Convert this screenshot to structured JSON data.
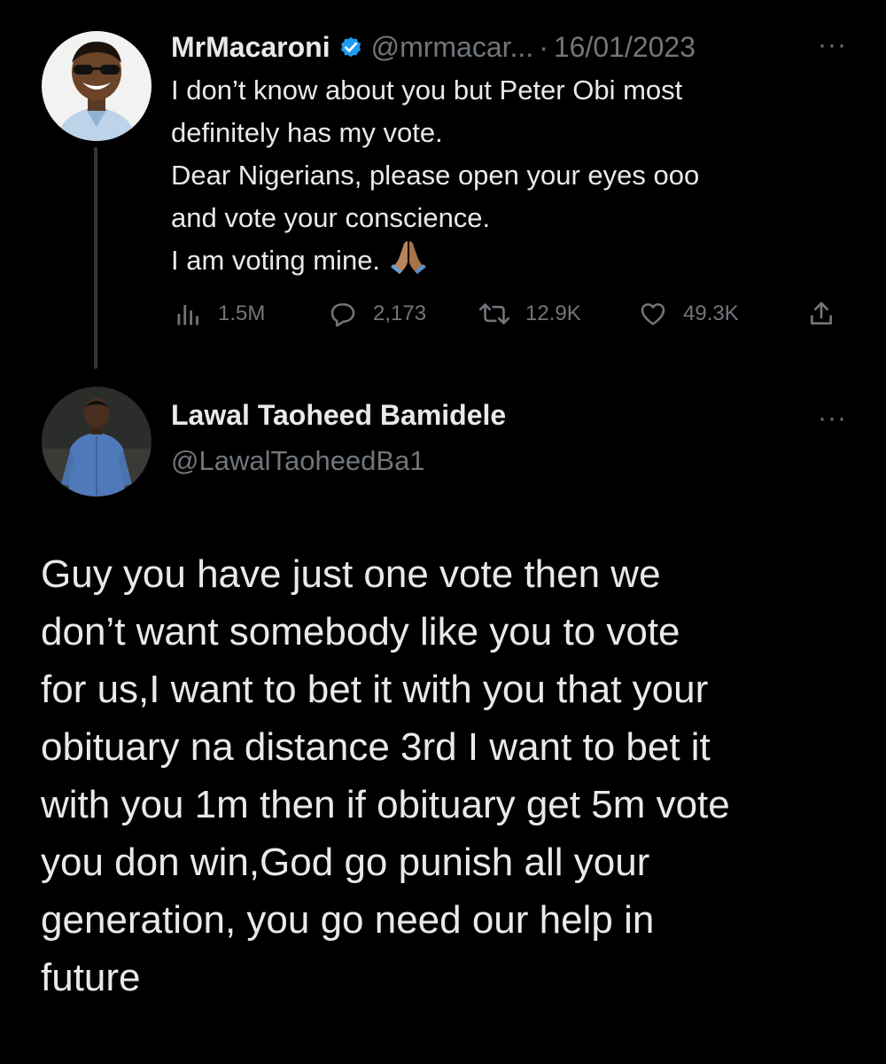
{
  "tweet": {
    "author_name": "MrMacaroni",
    "handle": "@mrmacar...",
    "separator": "·",
    "date": "16/01/2023",
    "more_label": "···",
    "lines": [
      "I don’t know about you but Peter Obi most",
      "definitely has my vote.",
      "Dear Nigerians, please open your eyes ooo",
      "and vote your conscience.",
      "I am voting mine."
    ],
    "emoji": "folded-hands-icon",
    "metrics": {
      "views": "1.5M",
      "replies": "2,173",
      "retweets": "12.9K",
      "likes": "49.3K"
    }
  },
  "reply": {
    "author_name": "Lawal Taoheed Bamidele",
    "handle": "@LawalTaoheedBa1",
    "more_label": "···",
    "lines": [
      "Guy you have just one vote then we",
      "don’t want somebody like you to vote",
      "for us,I want to bet it with you that your",
      "obituary na distance 3rd I want to bet it",
      "with you 1m then if obituary get 5m vote",
      "you don win,God go punish all your",
      "generation, you go need our help in",
      "future"
    ]
  },
  "colors": {
    "background": "#000000",
    "text": "#e7e9ea",
    "muted": "#71767b",
    "verified": "#1d9bf0",
    "thread_line": "#333639"
  }
}
